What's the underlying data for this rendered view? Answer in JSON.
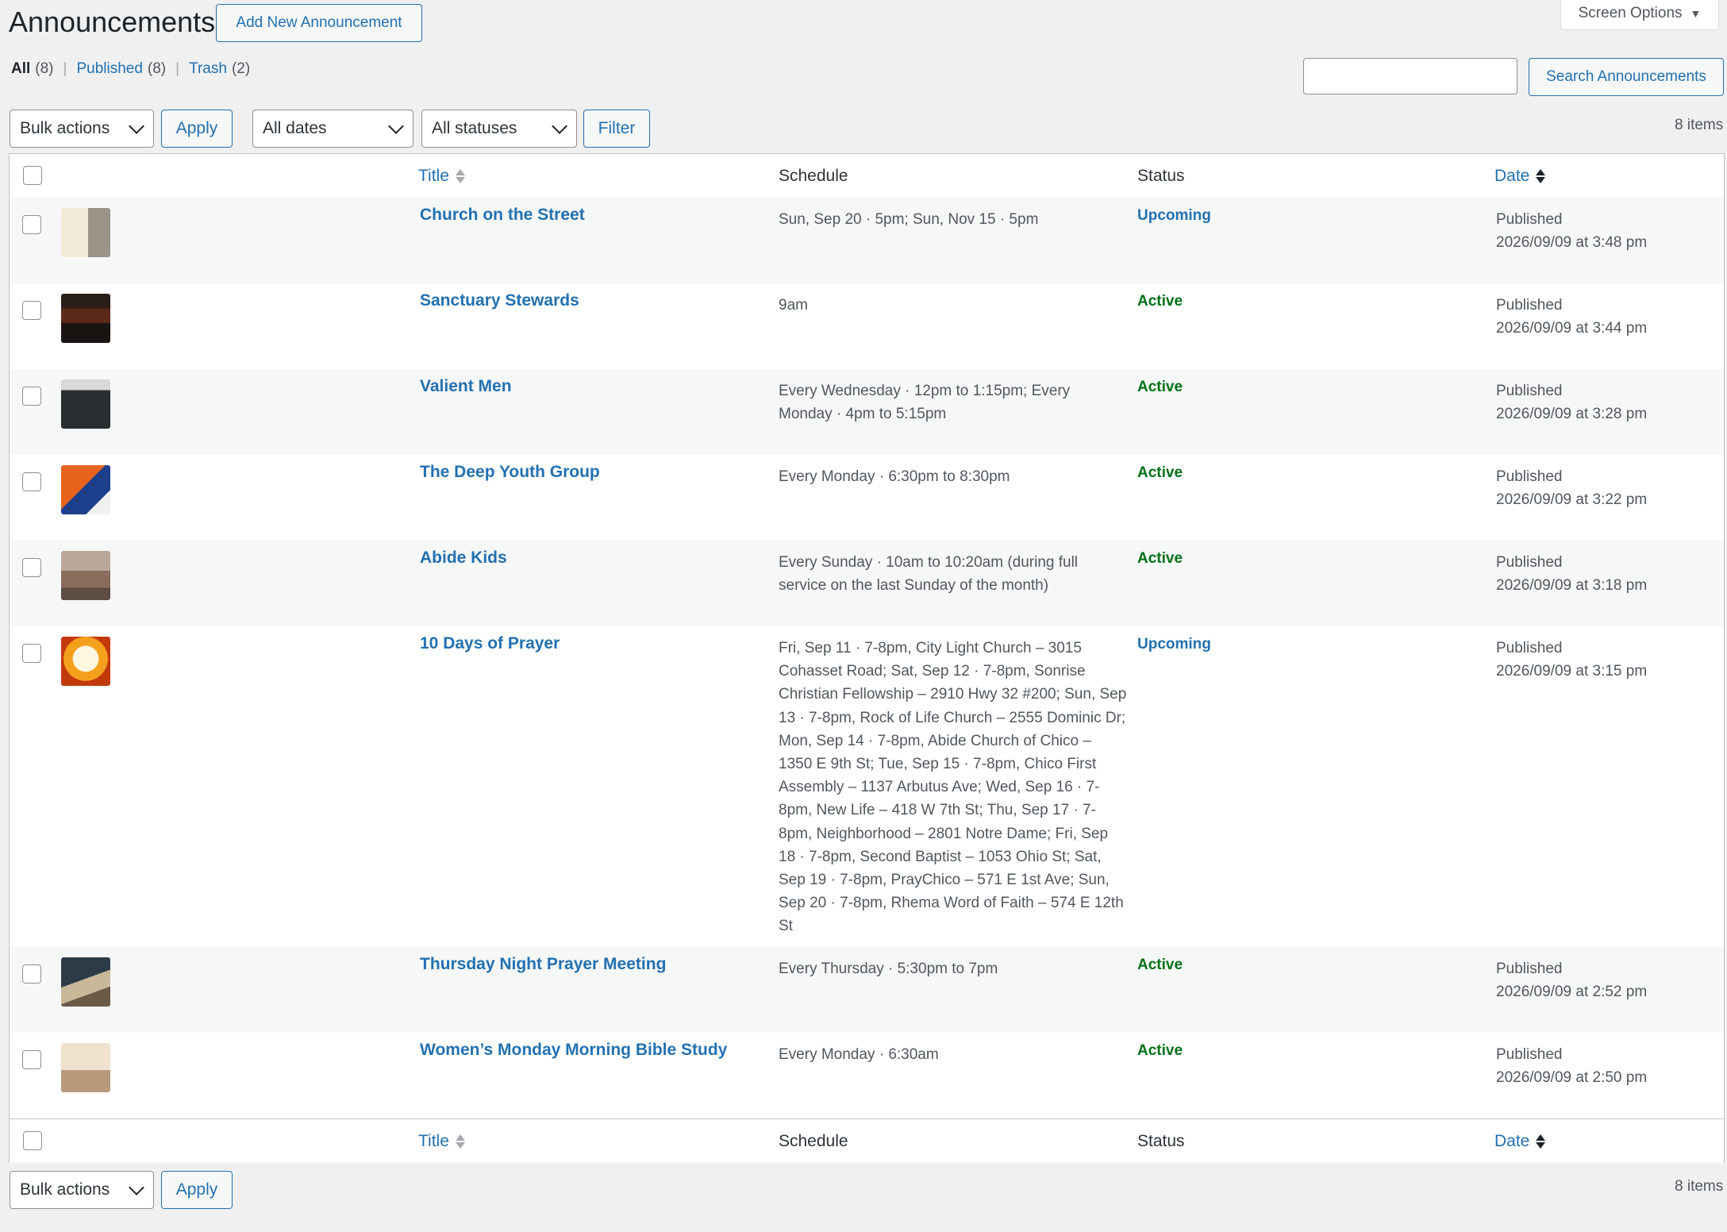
{
  "header": {
    "title": "Announcements",
    "add_new_label": "Add New Announcement",
    "screen_options_label": "Screen Options"
  },
  "views": [
    {
      "label": "All",
      "count": "(8)"
    },
    {
      "label": "Published",
      "count": "(8)"
    },
    {
      "label": "Trash",
      "count": "(2)"
    }
  ],
  "search": {
    "value": "",
    "button_label": "Search Announcements"
  },
  "top_nav": {
    "bulk_label": "Bulk actions",
    "apply_label": "Apply",
    "dates_label": "All dates",
    "statuses_label": "All statuses",
    "filter_label": "Filter",
    "items_count": "8 items"
  },
  "bottom_nav": {
    "bulk_label": "Bulk actions",
    "apply_label": "Apply",
    "items_count": "8 items"
  },
  "columns": {
    "title": "Title",
    "schedule": "Schedule",
    "status": "Status",
    "date": "Date"
  },
  "colors": {
    "link": "#2271b1",
    "active": "#007017",
    "upcoming": "#2271b1"
  },
  "rows": [
    {
      "title": "Church on the Street",
      "schedule": "Sun, Sep 20 · 5pm; Sun, Nov 15 · 5pm",
      "status": "Upcoming",
      "status_kind": "upcoming",
      "date_state": "Published",
      "date": "2026/09/09 at 3:48 pm",
      "thumb": "light-flyer"
    },
    {
      "title": "Sanctuary Stewards",
      "schedule": "9am",
      "status": "Active",
      "status_kind": "active",
      "date_state": "Published",
      "date": "2026/09/09 at 3:44 pm",
      "thumb": "dark-flyer"
    },
    {
      "title": "Valient Men",
      "schedule": "Every Wednesday · 12pm to 1:15pm; Every Monday · 4pm to 5:15pm",
      "status": "Active",
      "status_kind": "active",
      "date_state": "Published",
      "date": "2026/09/09 at 3:28 pm",
      "thumb": "dark-photo"
    },
    {
      "title": "The Deep Youth Group",
      "schedule": "Every Monday · 6:30pm to 8:30pm",
      "status": "Active",
      "status_kind": "active",
      "date_state": "Published",
      "date": "2026/09/09 at 3:22 pm",
      "thumb": "orange-flyer"
    },
    {
      "title": "Abide Kids",
      "schedule": "Every Sunday · 10am to 10:20am (during full service on the last Sunday of the month)",
      "status": "Active",
      "status_kind": "active",
      "date_state": "Published",
      "date": "2026/09/09 at 3:18 pm",
      "thumb": "kids-photo"
    },
    {
      "title": "10 Days of Prayer",
      "schedule": "Fri, Sep 11 · 7-8pm, City Light Church – 3015 Cohasset Road; Sat, Sep 12 · 7-8pm, Sonrise Christian Fellowship – 2910 Hwy 32 #200; Sun, Sep 13 · 7-8pm, Rock of Life Church – 2555 Dominic Dr; Mon, Sep 14 · 7-8pm, Abide Church of Chico – 1350 E 9th St; Tue, Sep 15 · 7-8pm, Chico First Assembly – 1137 Arbutus Ave; Wed, Sep 16 · 7-8pm, New Life – 418 W 7th St; Thu, Sep 17 · 7-8pm, Neighborhood – 2801 Notre Dame; Fri, Sep 18 · 7-8pm, Second Baptist – 1053 Ohio St; Sat, Sep 19 · 7-8pm, PrayChico – 571 E 1st Ave; Sun, Sep 20 · 7-8pm, Rhema Word of Faith – 574 E 12th St",
      "status": "Upcoming",
      "status_kind": "upcoming",
      "date_state": "Published",
      "date": "2026/09/09 at 3:15 pm",
      "thumb": "fire-flyer"
    },
    {
      "title": "Thursday Night Prayer Meeting",
      "schedule": "Every Thursday · 5:30pm to 7pm",
      "status": "Active",
      "status_kind": "active",
      "date_state": "Published",
      "date": "2026/09/09 at 2:52 pm",
      "thumb": "bible-photo"
    },
    {
      "title": "Women’s Monday Morning Bible Study",
      "schedule": "Every Monday · 6:30am",
      "status": "Active",
      "status_kind": "active",
      "date_state": "Published",
      "date": "2026/09/09 at 2:50 pm",
      "thumb": "ladies-flyer"
    }
  ]
}
